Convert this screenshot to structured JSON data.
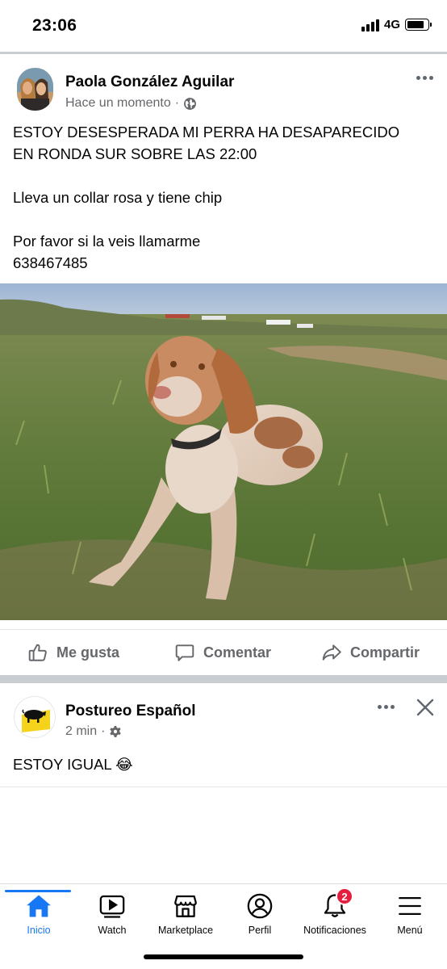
{
  "status_bar": {
    "time": "23:06",
    "network": "4G",
    "battery_level": 0.85,
    "signal_bars": 4
  },
  "posts": [
    {
      "author": "Paola González Aguilar",
      "timestamp": "Hace un momento",
      "privacy_icon": "globe-icon",
      "lines": [
        "ESTOY DESESPERADA MI PERRA HA DESAPARECIDO",
        "EN RONDA SUR SOBRE LAS 22:00",
        "",
        "Lleva un collar rosa y tiene chip",
        "",
        "Por favor si la veis llamarme",
        "638467485"
      ],
      "actions": {
        "like": "Me gusta",
        "comment": "Comentar",
        "share": "Compartir"
      }
    },
    {
      "author": "Postureo Español",
      "timestamp": "2 min",
      "privacy_icon": "gear-icon",
      "text": "ESTOY IGUAL 😂"
    }
  ],
  "tabs": [
    {
      "label": "Inicio",
      "icon": "home-icon",
      "active": true
    },
    {
      "label": "Watch",
      "icon": "video-icon"
    },
    {
      "label": "Marketplace",
      "icon": "shop-icon"
    },
    {
      "label": "Perfil",
      "icon": "profile-icon"
    },
    {
      "label": "Notificaciones",
      "icon": "bell-icon",
      "badge": "2"
    },
    {
      "label": "Menú",
      "icon": "menu-icon"
    }
  ],
  "colors": {
    "accent": "#1877f2",
    "badge": "#e41e3f",
    "secondary_text": "#65676b",
    "divider": "#c9ccd1"
  }
}
